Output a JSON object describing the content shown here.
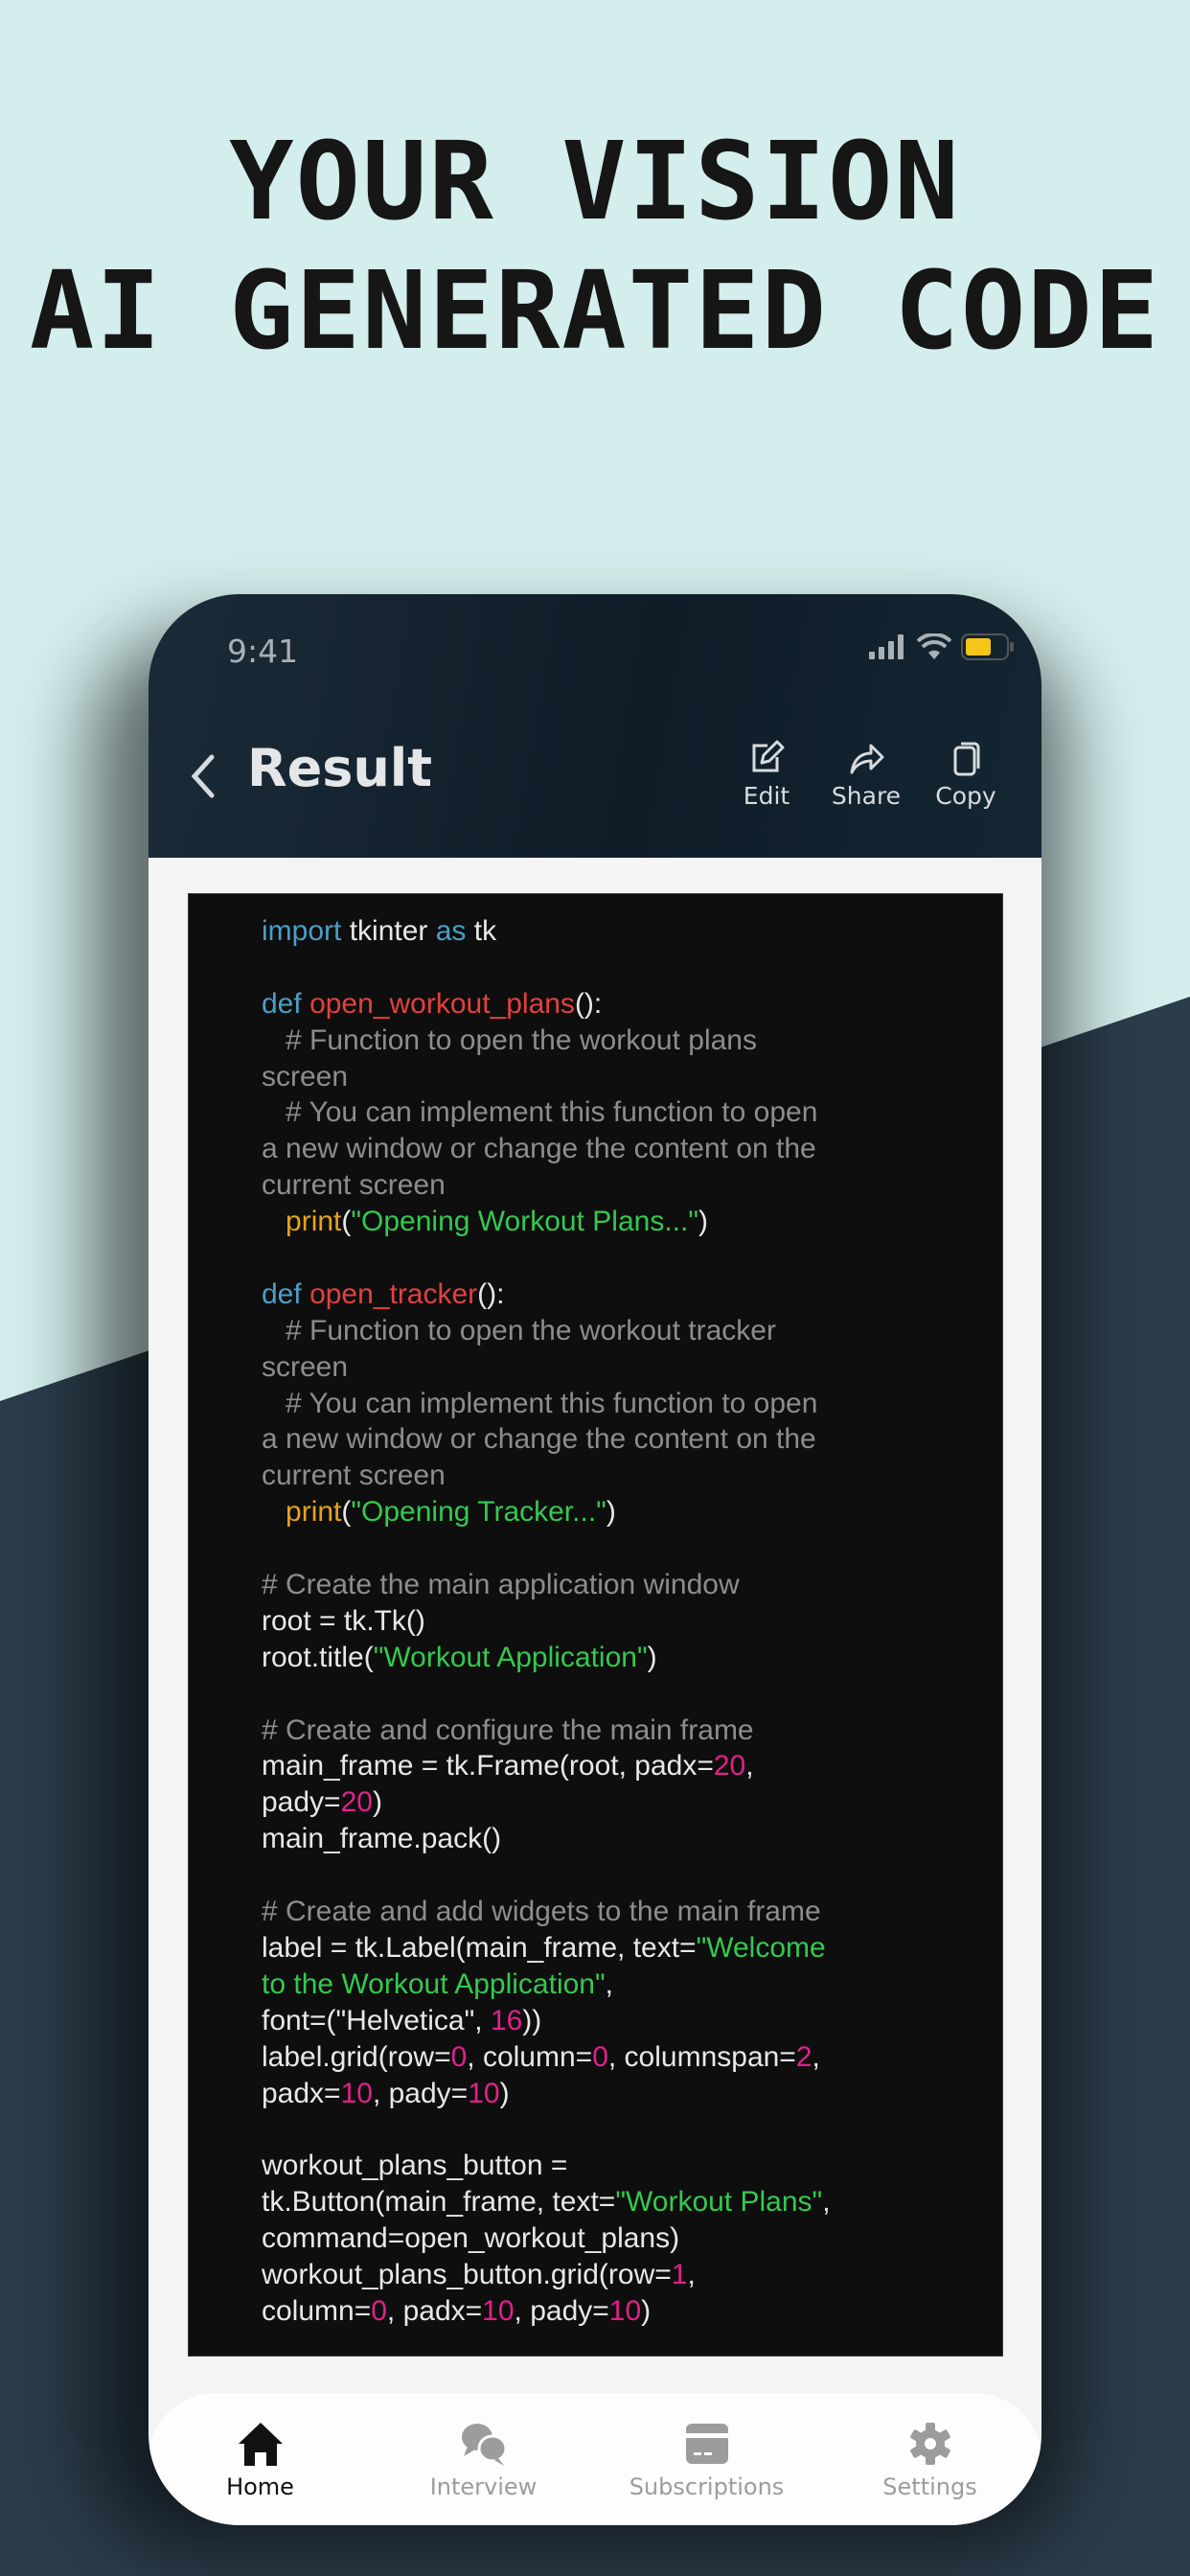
{
  "headline": {
    "line1": "YOUR VISION",
    "line2": "AI GENERATED CODE"
  },
  "colors": {
    "bg_light": "#d3eeec",
    "bg_dark": "#2b3c4a",
    "header": "#0f1c28",
    "keyword": "#4a9fc7",
    "function": "#e2413f",
    "comment": "#8d8d8d",
    "string": "#34c94f",
    "number": "#e0218a",
    "builtin": "#e7a21a",
    "battery": "#f5c518"
  },
  "status_bar": {
    "time": "9:41",
    "icons": [
      "signal-icon",
      "wifi-icon",
      "battery-icon"
    ]
  },
  "header": {
    "back_icon": "chevron-left-icon",
    "title": "Result",
    "actions": [
      {
        "label": "Edit",
        "icon": "edit-icon"
      },
      {
        "label": "Share",
        "icon": "share-icon"
      },
      {
        "label": "Copy",
        "icon": "copy-icon"
      }
    ]
  },
  "code_lines": [
    [
      [
        "kw",
        "import"
      ],
      [
        "t",
        " tkinter "
      ],
      [
        "kw",
        "as"
      ],
      [
        "t",
        " tk"
      ]
    ],
    [],
    [
      [
        "kw",
        "def"
      ],
      [
        "t",
        " "
      ],
      [
        "fn",
        "open_workout_plans"
      ],
      [
        "t",
        "():"
      ]
    ],
    [
      [
        "cm",
        "   # Function to open the workout plans"
      ]
    ],
    [
      [
        "cm",
        "screen"
      ]
    ],
    [
      [
        "cm",
        "   # You can implement this function to open"
      ]
    ],
    [
      [
        "cm",
        "a new window or change the content on the"
      ]
    ],
    [
      [
        "cm",
        "current screen"
      ]
    ],
    [
      [
        "t",
        "   "
      ],
      [
        "pr",
        "print"
      ],
      [
        "t",
        "("
      ],
      [
        "st",
        "\"Opening Workout Plans...\""
      ],
      [
        "t",
        ")"
      ]
    ],
    [],
    [
      [
        "kw",
        "def"
      ],
      [
        "t",
        " "
      ],
      [
        "fn",
        "open_tracker"
      ],
      [
        "t",
        "():"
      ]
    ],
    [
      [
        "cm",
        "   # Function to open the workout tracker"
      ]
    ],
    [
      [
        "cm",
        "screen"
      ]
    ],
    [
      [
        "cm",
        "   # You can implement this function to open"
      ]
    ],
    [
      [
        "cm",
        "a new window or change the content on the"
      ]
    ],
    [
      [
        "cm",
        "current screen"
      ]
    ],
    [
      [
        "t",
        "   "
      ],
      [
        "pr",
        "print"
      ],
      [
        "t",
        "("
      ],
      [
        "st",
        "\"Opening Tracker...\""
      ],
      [
        "t",
        ")"
      ]
    ],
    [],
    [
      [
        "cm",
        "# Create the main application window"
      ]
    ],
    [
      [
        "t",
        "root = tk.Tk()"
      ]
    ],
    [
      [
        "t",
        "root.title("
      ],
      [
        "st",
        "\"Workout Application\""
      ],
      [
        "t",
        ")"
      ]
    ],
    [],
    [
      [
        "cm",
        "# Create and configure the main frame"
      ]
    ],
    [
      [
        "t",
        "main_frame = tk.Frame(root, padx="
      ],
      [
        "nm",
        "20"
      ],
      [
        "t",
        ","
      ]
    ],
    [
      [
        "t",
        "pady="
      ],
      [
        "nm",
        "20"
      ],
      [
        "t",
        ")"
      ]
    ],
    [
      [
        "t",
        "main_frame.pack()"
      ]
    ],
    [],
    [
      [
        "cm",
        "# Create and add widgets to the main frame"
      ]
    ],
    [
      [
        "t",
        "label = tk.Label(main_frame, text="
      ],
      [
        "st",
        "\"Welcome"
      ]
    ],
    [
      [
        "st",
        "to the Workout Application\""
      ],
      [
        "t",
        ","
      ]
    ],
    [
      [
        "t",
        "font=(\"Helvetica\", "
      ],
      [
        "nm",
        "16"
      ],
      [
        "t",
        "))"
      ]
    ],
    [
      [
        "t",
        "label.grid(row="
      ],
      [
        "nm",
        "0"
      ],
      [
        "t",
        ", column="
      ],
      [
        "nm",
        "0"
      ],
      [
        "t",
        ", columnspan="
      ],
      [
        "nm",
        "2"
      ],
      [
        "t",
        ","
      ]
    ],
    [
      [
        "t",
        "padx="
      ],
      [
        "nm",
        "10"
      ],
      [
        "t",
        ", pady="
      ],
      [
        "nm",
        "10"
      ],
      [
        "t",
        ")"
      ]
    ],
    [],
    [
      [
        "t",
        "workout_plans_button ="
      ]
    ],
    [
      [
        "t",
        "tk.Button(main_frame, text="
      ],
      [
        "st",
        "\"Workout Plans\""
      ],
      [
        "t",
        ","
      ]
    ],
    [
      [
        "t",
        "command=open_workout_plans)"
      ]
    ],
    [
      [
        "t",
        "workout_plans_button.grid(row="
      ],
      [
        "nm",
        "1"
      ],
      [
        "t",
        ","
      ]
    ],
    [
      [
        "t",
        "column="
      ],
      [
        "nm",
        "0"
      ],
      [
        "t",
        ", padx="
      ],
      [
        "nm",
        "10"
      ],
      [
        "t",
        ", pady="
      ],
      [
        "nm",
        "10"
      ],
      [
        "t",
        ")"
      ]
    ]
  ],
  "tabbar": {
    "items": [
      {
        "label": "Home",
        "icon": "home-icon",
        "active": true
      },
      {
        "label": "Interview",
        "icon": "chat-bubbles-icon",
        "active": false
      },
      {
        "label": "Subscriptions",
        "icon": "credit-card-icon",
        "active": false
      },
      {
        "label": "Settings",
        "icon": "gear-icon",
        "active": false
      }
    ]
  }
}
